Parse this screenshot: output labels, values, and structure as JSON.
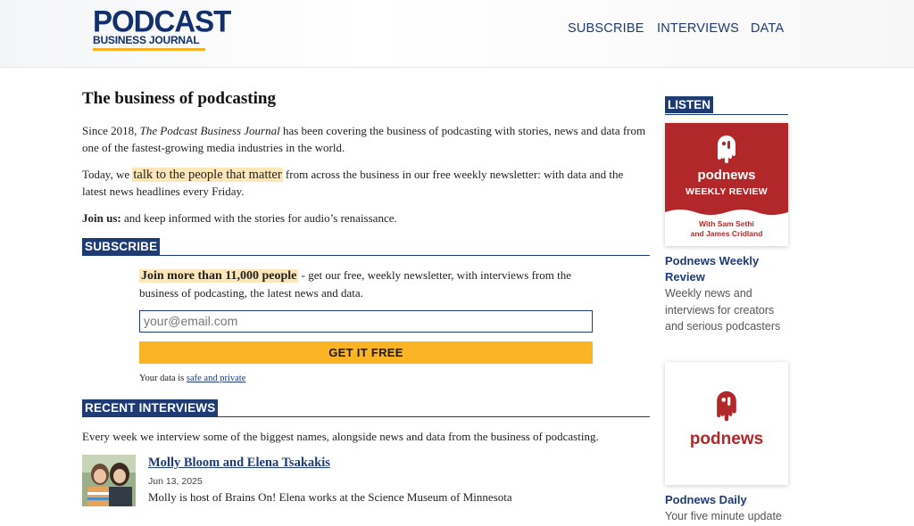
{
  "header": {
    "logo_line1": "PODCAST",
    "logo_line2": "BUSINESS JOURNAL",
    "nav": [
      "SUBSCRIBE",
      "INTERVIEWS",
      "DATA"
    ]
  },
  "intro": {
    "title": "The business of podcasting",
    "p1_pre": "Since 2018, ",
    "p1_em": "The Podcast Business Journal",
    "p1_post": " has been covering the business of podcasting with stories, news and data from one of the fastest-growing media industries in the world.",
    "p2_pre": "Today, we ",
    "p2_hl": "talk to the people that matter",
    "p2_post": " from across the business in our free weekly newsletter: with data and the latest news headlines every Friday.",
    "p3_bold": "Join us:",
    "p3_post": " and keep informed with the stories for audio’s renaissance."
  },
  "subscribe": {
    "heading": "SUBSCRIBE",
    "join": "Join more than 11,000 people",
    "text": " - get our free, weekly newsletter, with interviews from the business of podcasting, the latest news and data.",
    "placeholder": "your@email.com",
    "button": "GET IT FREE",
    "privacy_pre": "Your data is ",
    "privacy_link": "safe and private"
  },
  "interviews": {
    "heading": "RECENT INTERVIEWS",
    "intro": "Every week we interview some of the biggest names, alongside news and data from the business of podcasting.",
    "items": [
      {
        "title": "Molly Bloom and Elena Tsakakis",
        "date": "Jun 13, 2025",
        "desc": "Molly is host of Brains On! Elena works at the Science Museum of Minnesota"
      }
    ]
  },
  "sidebar": {
    "heading": "LISTEN",
    "cards": [
      {
        "brand": "podnews",
        "subtitle": "WEEKLY REVIEW",
        "with": "With Sam Sethi",
        "with2": "and James Cridland",
        "title": "Podnews Weekly Review",
        "desc": "Weekly news and interviews for creators and serious podcasters"
      },
      {
        "brand": "podnews",
        "title": "Podnews Daily",
        "desc": "Your five minute update for podcasting and on-"
      }
    ]
  },
  "colors": {
    "navy": "#1f3b73",
    "gold": "#fbb426",
    "highlight": "#fde6b8",
    "podnews_red": "#b2282a"
  }
}
